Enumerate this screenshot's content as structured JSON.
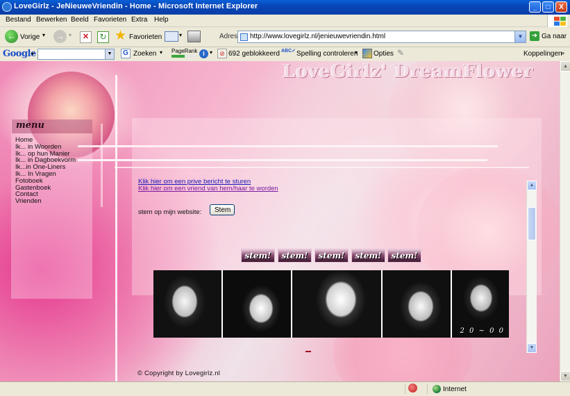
{
  "window": {
    "title": "LoveGirlz - JeNieuweVriendin - Home - Microsoft Internet Explorer",
    "minimize": "_",
    "maximize": "□",
    "close": "X"
  },
  "menubar": [
    "Bestand",
    "Bewerken",
    "Beeld",
    "Favorieten",
    "Extra",
    "Help"
  ],
  "toolbar": {
    "back_label": "Vorige",
    "favorites_label": "Favorieten",
    "address_label": "Adres",
    "address_value": "http://www.lovegirlz.nl/jenieuwevriendin.html",
    "go_label": "Ga naar"
  },
  "googlebar": {
    "logo": "Google",
    "search_label": "Zoeken",
    "pagerank_label": "PageRank",
    "blocked_label": "692 geblokkeerd",
    "spellcheck_label": "Spelling controleren",
    "options_label": "Opties",
    "links_label": "Koppelingen"
  },
  "page": {
    "header_title": "LoveGirlz' DreamFlower",
    "menu_title": "menu",
    "menu_items": [
      "Home",
      "Ik... in Woorden",
      "Ik... op hun Manier",
      "Ik... in Dagboekvorm",
      "Ik...in One-Liners",
      "Ik... In Vragen",
      "Fotoboek",
      "Gastenboek",
      "Contact",
      "Vrienden"
    ],
    "link_private_message": "Klik hier om een prive bericht te sturen",
    "link_become_friend": "Klik hier om een vriend van hem/haar te worden",
    "vote_text": "stem op mijn website:",
    "vote_button": "Stem",
    "vote_badges": [
      "stem!",
      "stem!",
      "stem!",
      "stem!",
      "stem!"
    ],
    "photo_caption": "2 0 ~ 0 0",
    "copyright": "© Copyright by Lovegirlz.nl"
  },
  "statusbar": {
    "zone": "Internet"
  },
  "colors": {
    "titlebar": "#0a4fc8",
    "link_unvisited": "#1a1ab8",
    "link_visited": "#7a1aa0",
    "page_pink": "#f2a8c4"
  }
}
